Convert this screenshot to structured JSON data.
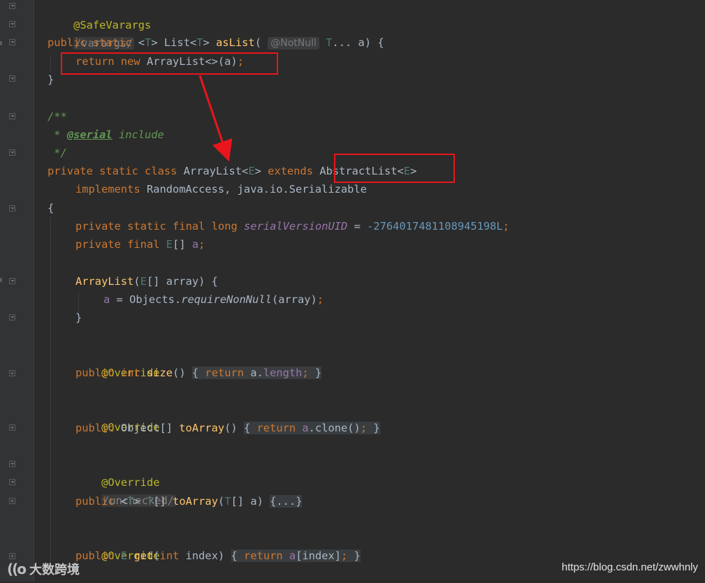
{
  "editor": {
    "lines": {
      "l1": {
        "annotation": "@SafeVarargs"
      },
      "l2": {
        "suppress": "/varargs/"
      },
      "l3": {
        "kw_public": "public",
        "kw_static": "static",
        "lt": "<",
        "tp": "T",
        "gt": ">",
        "list": " List",
        "lt2": "<",
        "tp2": "T",
        "gt2": ">",
        "fn": "asList",
        "open": "(",
        "hint": "@NotNull",
        "tp3": "T",
        "rest": "... a) {"
      },
      "l4": {
        "kw_return": "return",
        "kw_new": "new",
        "rest": " ArrayList<>(a)",
        "semi": ";"
      },
      "l5": {
        "text": "}"
      },
      "l6": {
        "text": "/**"
      },
      "l7": {
        "star": " * ",
        "tag": "@serial",
        "rest": " include"
      },
      "l8": {
        "text": " */"
      },
      "l9": {
        "kw1": "private",
        "kw2": "static",
        "kw3": "class",
        "name": " ArrayList<",
        "tp": "E",
        "gt": ">",
        "kw4": "extends",
        "sup": " AbstractList<",
        "tp2": "E",
        "gt2": ">"
      },
      "l10": {
        "kw": "implements",
        "rest": " RandomAccess, java.io.Serializable"
      },
      "l11": {
        "text": "{"
      },
      "l12": {
        "kw1": "private",
        "kw2": "static",
        "kw3": "final",
        "kw4": "long",
        "field": "serialVersionUID",
        "eq": " = ",
        "num": "-2764017481108945198L",
        "semi": ";"
      },
      "l13": {
        "kw1": "private",
        "kw2": "final",
        "tp": "E",
        "arr": "[] ",
        "field": "a",
        "semi": ";"
      },
      "l14": {
        "fn": "ArrayList",
        "open": "(",
        "tp": "E",
        "rest": "[] array) {"
      },
      "l15": {
        "field": "a",
        "eq": " = Objects.",
        "call": "requireNonNull",
        "args": "(array)",
        "semi": ";"
      },
      "l16": {
        "text": "}"
      },
      "l17": {
        "annotation": "@Override"
      },
      "l18": {
        "kw1": "public",
        "kw2": "int",
        "fn": "size",
        "paren": "() ",
        "fb_open": "{ ",
        "kw_ret": "return",
        "field_a": " a.",
        "field": "length",
        "semi": ";",
        "fb_close": " }"
      },
      "l19": {
        "annotation": "@Override"
      },
      "l20": {
        "kw1": "public",
        "type": " Object[] ",
        "fn": "toArray",
        "paren": "() ",
        "fb_open": "{ ",
        "kw_ret": "return",
        "field": " a",
        "call": ".clone()",
        "semi": ";",
        "fb_close": " }"
      },
      "l21": {
        "annotation": "@Override"
      },
      "l22": {
        "suppress": "/unchecked/"
      },
      "l23": {
        "kw1": "public",
        "lt": "<",
        "tp": "T",
        "gt": "> ",
        "tp2": "T",
        "arr": "[] ",
        "fn": "toArray",
        "open": "(",
        "tp3": "T",
        "rest": "[] a) ",
        "fold": "{...}"
      },
      "l24": {
        "annotation": "@Override"
      },
      "l25": {
        "kw1": "public",
        "tp": "E",
        "fn": "get",
        "open": "(",
        "kw2": "int",
        "rest": " index) ",
        "fb_open": "{ ",
        "kw_ret": "return",
        "field": " a",
        "idx": "[index]",
        "semi": ";",
        "fb_close": " }"
      }
    }
  },
  "watermark": {
    "left_logo": "((o",
    "left_text": "大数跨境",
    "right_text": "https://blog.csdn.net/zwwhnly"
  },
  "colors": {
    "background": "#2b2b2b",
    "gutter": "#313335",
    "keyword": "#cc7832",
    "annotation": "#bbb529",
    "function": "#ffc66d",
    "highlight_box": "#e8161c"
  }
}
